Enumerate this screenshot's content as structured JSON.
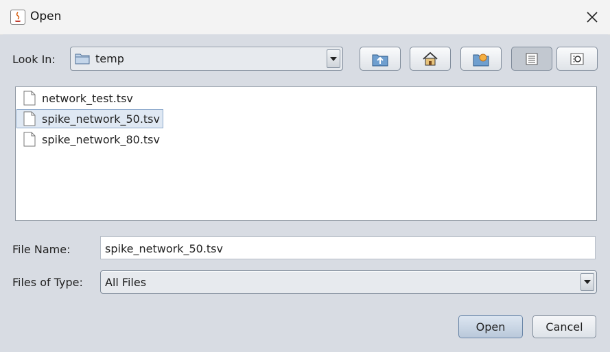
{
  "window": {
    "title": "Open",
    "app_icon": "java-coffee-icon"
  },
  "look_in": {
    "label": "Look In:",
    "value": "temp",
    "folder_icon": "folder-icon"
  },
  "toolbar": {
    "up": "up-folder-icon",
    "home": "home-icon",
    "new_folder": "new-folder-icon",
    "list_view": "list-view-icon",
    "details_view": "details-view-icon"
  },
  "files": [
    {
      "name": "network_test.tsv",
      "selected": false
    },
    {
      "name": "spike_network_50.tsv",
      "selected": true
    },
    {
      "name": "spike_network_80.tsv",
      "selected": false
    }
  ],
  "file_name": {
    "label": "File Name:",
    "value": "spike_network_50.tsv"
  },
  "file_type": {
    "label": "Files of Type:",
    "value": "All Files"
  },
  "buttons": {
    "open": "Open",
    "cancel": "Cancel"
  },
  "colors": {
    "background": "#d8dce3",
    "selection": "#dfe8f3",
    "border": "#7e8a99"
  }
}
